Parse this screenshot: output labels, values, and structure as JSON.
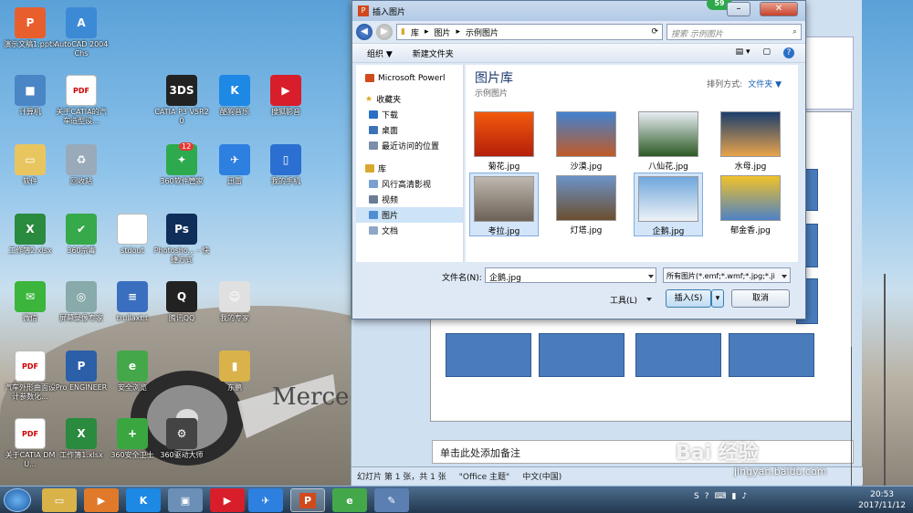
{
  "desktop": {
    "icons": [
      {
        "label": "演示文稿1.pptx",
        "color": "#e85f2d",
        "glyph": "P"
      },
      {
        "label": "AutoCAD 2004 Chs",
        "color": "#3c8ad6",
        "glyph": "A"
      },
      {
        "label": "计算机",
        "color": "#4a86c5",
        "glyph": "■"
      },
      {
        "label": "关于CATIA的汽车造型设...",
        "color": "#ffffff",
        "glyph": "PDF"
      },
      {
        "label": "CATIA P3 V5R20",
        "color": "#222222",
        "glyph": "3DS"
      },
      {
        "label": "酷狗音乐",
        "color": "#1e88e5",
        "glyph": "K"
      },
      {
        "label": "搜狐影音",
        "color": "#d81e2a",
        "glyph": "▶"
      },
      {
        "label": "软件",
        "color": "#e9c560",
        "glyph": "▭"
      },
      {
        "label": "回收站",
        "color": "#9ab",
        "glyph": "♻"
      },
      {
        "label": "360软件管家",
        "color": "#2eaa4e",
        "glyph": "✦"
      },
      {
        "label": "迅雷",
        "color": "#2d7fe0",
        "glyph": "✈"
      },
      {
        "label": "我的手机",
        "color": "#2a6fd1",
        "glyph": "▯"
      },
      {
        "label": "工作簿2.xlsx",
        "color": "#2a8a3e",
        "glyph": "X"
      },
      {
        "label": "360杀毒",
        "color": "#36a94a",
        "glyph": "✔"
      },
      {
        "label": "stdout",
        "color": "#ffffff",
        "glyph": ""
      },
      {
        "label": "Photosho... - 快捷方式",
        "color": "#0f2e5a",
        "glyph": "Ps"
      },
      {
        "label": "微信",
        "color": "#3bb53b",
        "glyph": "✉"
      },
      {
        "label": "屏幕录像专家",
        "color": "#8aa",
        "glyph": "◎"
      },
      {
        "label": "trullaxt.t",
        "color": "#3a6fc0",
        "glyph": "≡"
      },
      {
        "label": "腾讯QQ",
        "color": "#222",
        "glyph": "Q"
      },
      {
        "label": "我的专家",
        "color": "#e0e0e0",
        "glyph": "☺"
      },
      {
        "label": "汽车外形曲面设计参数化...",
        "color": "#ffffff",
        "glyph": "PDF"
      },
      {
        "label": "Pro ENGINEER",
        "color": "#2b5fa8",
        "glyph": "P"
      },
      {
        "label": "安全浏览",
        "color": "#44a84a",
        "glyph": "e"
      },
      {
        "label": "东鹏",
        "color": "#d9b24a",
        "glyph": "▮"
      },
      {
        "label": "关于CATIA DMU...",
        "color": "#ffffff",
        "glyph": "PDF"
      },
      {
        "label": "工作簿1.xlsx",
        "color": "#2a8a3e",
        "glyph": "X"
      },
      {
        "label": "360安全卫士",
        "color": "#3aa640",
        "glyph": "+"
      },
      {
        "label": "360驱动大师",
        "color": "#444",
        "glyph": "⚙"
      }
    ],
    "badge_12": "12",
    "mercedes_text": "Merced"
  },
  "ppt": {
    "notes_placeholder": "单击此处添加备注",
    "status": {
      "slide": "幻灯片 第 1 张，共 1 张",
      "theme": "\"Office 主题\"",
      "lang": "中文(中国)"
    }
  },
  "dialog": {
    "title": "插入图片",
    "badge": "59",
    "breadcrumb": [
      "库",
      "图片",
      "示例图片"
    ],
    "search_placeholder": "搜索 示例图片",
    "toolbar": {
      "organize": "组织 ▼",
      "new_folder": "新建文件夹"
    },
    "nav": {
      "top_item": "Microsoft Powerl",
      "favorites": "收藏夹",
      "fav_items": [
        "下载",
        "桌面",
        "最近访问的位置"
      ],
      "libraries": "库",
      "lib_items": [
        "风行高清影视",
        "视频",
        "图片",
        "文档"
      ]
    },
    "library_title": "图片库",
    "library_subtitle": "示例图片",
    "sort_label": "排列方式:",
    "sort_value": "文件夹 ▼",
    "thumbs": [
      {
        "name": "菊花.jpg",
        "c1": "#f25a0c",
        "c2": "#b51f0a"
      },
      {
        "name": "沙漠.jpg",
        "c1": "#3f82d1",
        "c2": "#c25a26"
      },
      {
        "name": "八仙花.jpg",
        "c1": "#e8edf4",
        "c2": "#2c5a24"
      },
      {
        "name": "水母.jpg",
        "c1": "#1b3e6c",
        "c2": "#e8a34a"
      },
      {
        "name": "考拉.jpg",
        "c1": "#bfb8ae",
        "c2": "#6b6157"
      },
      {
        "name": "灯塔.jpg",
        "c1": "#6c93c9",
        "c2": "#6b4f2e"
      },
      {
        "name": "企鹅.jpg",
        "c1": "#6fa7dc",
        "c2": "#eef2f6"
      },
      {
        "name": "郁金香.jpg",
        "c1": "#f1c228",
        "c2": "#4d82c6"
      }
    ],
    "filename_label": "文件名(N):",
    "filename_value": "企鹅.jpg",
    "filetype_value": "所有图片(*.emf;*.wmf;*.jpg;*.ji",
    "tools_label": "工具(L)",
    "insert_label": "插入(S)",
    "cancel_label": "取消"
  },
  "taskbar": {
    "time": "20:53",
    "date": "2017/11/12"
  },
  "watermark": {
    "brand": "Bai 经验",
    "url": "jingyan.baidu.com"
  }
}
